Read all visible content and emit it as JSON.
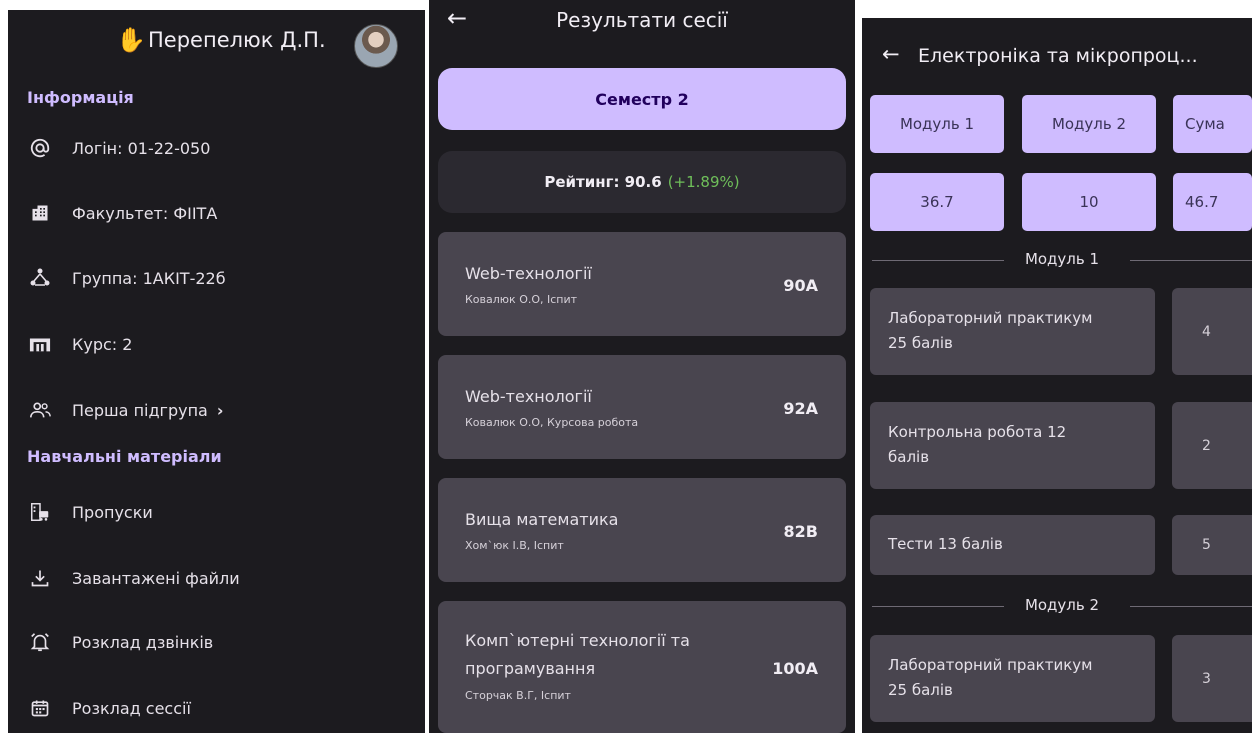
{
  "profile": {
    "wave_emoji": "✋",
    "name": "Перепелюк Д.П.",
    "info_title": "Інформація",
    "items": [
      {
        "icon": "at-icon",
        "label": "Логін: 01-22-050"
      },
      {
        "icon": "building-icon",
        "label": "Факультет: ФІІТА"
      },
      {
        "icon": "group-icon",
        "label": "Группа: 1АКІТ-22б"
      },
      {
        "icon": "school-icon",
        "label": "Курс: 2"
      },
      {
        "icon": "people-icon",
        "label": "Перша підгрупа",
        "chevron": "›"
      }
    ],
    "materials_title": "Навчальні матеріали",
    "materials": [
      {
        "icon": "pass-icon",
        "label": "Пропуски"
      },
      {
        "icon": "download-icon",
        "label": "Завантажені файли"
      },
      {
        "icon": "alarm-icon",
        "label": "Розклад дзвінків"
      },
      {
        "icon": "calendar-icon",
        "label": "Розклад сессії"
      }
    ]
  },
  "session": {
    "back_icon": "←",
    "title": "Результати сесії",
    "semester": "Семестр 2",
    "rating": "Рейтинг: 90.6",
    "rating_delta": "(+1.89%)",
    "subjects": [
      {
        "name": "Web-технології",
        "teacher": "Ковалюк О.О, Іспит",
        "grade": "90A"
      },
      {
        "name": "Web-технології",
        "teacher": "Ковалюк О.О, Курсова робота",
        "grade": "92A"
      },
      {
        "name": "Вища математика",
        "teacher": "Хом`юк І.В, Іспит",
        "grade": "82B"
      },
      {
        "name_line1": "Комп`ютерні технології та",
        "name_line2": "програмування",
        "teacher": "Сторчак В.Г, Іспит",
        "grade": "100A"
      }
    ]
  },
  "subject_detail": {
    "back_icon": "←",
    "title": "Електроніка та мікропроц...",
    "headers": [
      "Модуль 1",
      "Модуль 2",
      "Сума"
    ],
    "values": [
      "36.7",
      "10",
      "46.7"
    ],
    "module1_title": "Модуль 1",
    "module1_rows": [
      {
        "line1": "Лабораторний практикум",
        "line2": "25 балів",
        "score": "4"
      },
      {
        "line1": "Контрольна робота 12",
        "line2": "балів",
        "score": "2"
      },
      {
        "line1": "Тести 13 балів",
        "line2": "",
        "score": "5"
      }
    ],
    "module2_title": "Модуль 2",
    "module2_rows": [
      {
        "line1": "Лабораторний практикум",
        "line2": "25 балів",
        "score": "3"
      }
    ]
  }
}
